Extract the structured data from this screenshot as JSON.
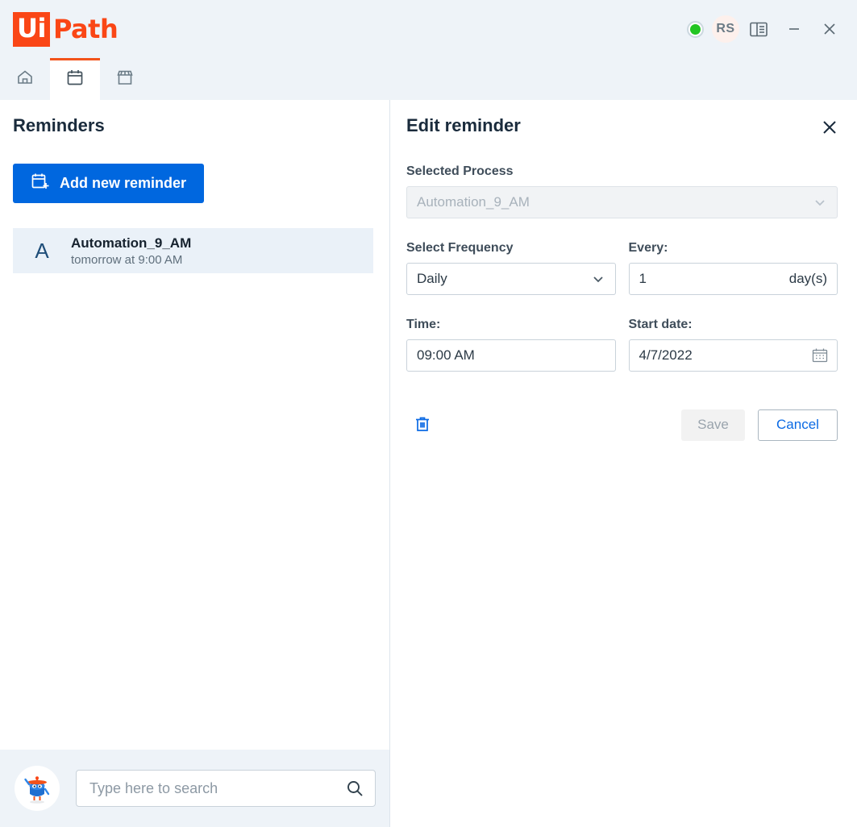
{
  "window": {
    "brand_box": "Ui",
    "brand_text": "Path",
    "brand_color": "#fa4616",
    "status_indicator": "online",
    "user_initials": "RS",
    "controls": {
      "panel_label": "layout-panel",
      "minimize_label": "minimize",
      "close_label": "close"
    }
  },
  "tabs": [
    {
      "name": "home",
      "icon": "home-icon",
      "active": false
    },
    {
      "name": "reminders",
      "icon": "calendar-icon",
      "active": true
    },
    {
      "name": "marketplace",
      "icon": "store-icon",
      "active": false
    }
  ],
  "sidebar": {
    "title": "Reminders",
    "add_button": "Add new reminder",
    "add_button_color": "#0067df",
    "items": [
      {
        "avatar": "A",
        "name": "Automation_9_AM",
        "subtitle": "tomorrow at 9:00 AM"
      }
    ]
  },
  "search": {
    "placeholder": "Type here to search",
    "value": ""
  },
  "editor": {
    "title": "Edit reminder",
    "process": {
      "label": "Selected Process",
      "value": "Automation_9_AM",
      "disabled": true
    },
    "frequency": {
      "label": "Select Frequency",
      "value": "Daily"
    },
    "every": {
      "label": "Every:",
      "value": "1",
      "unit": "day(s)"
    },
    "time": {
      "label": "Time:",
      "value": "09:00 AM"
    },
    "start_date": {
      "label": "Start date:",
      "value": "4/7/2022"
    },
    "buttons": {
      "delete": "delete",
      "save": "Save",
      "save_disabled": true,
      "cancel": "Cancel",
      "accent_color": "#0b6ae4"
    }
  }
}
